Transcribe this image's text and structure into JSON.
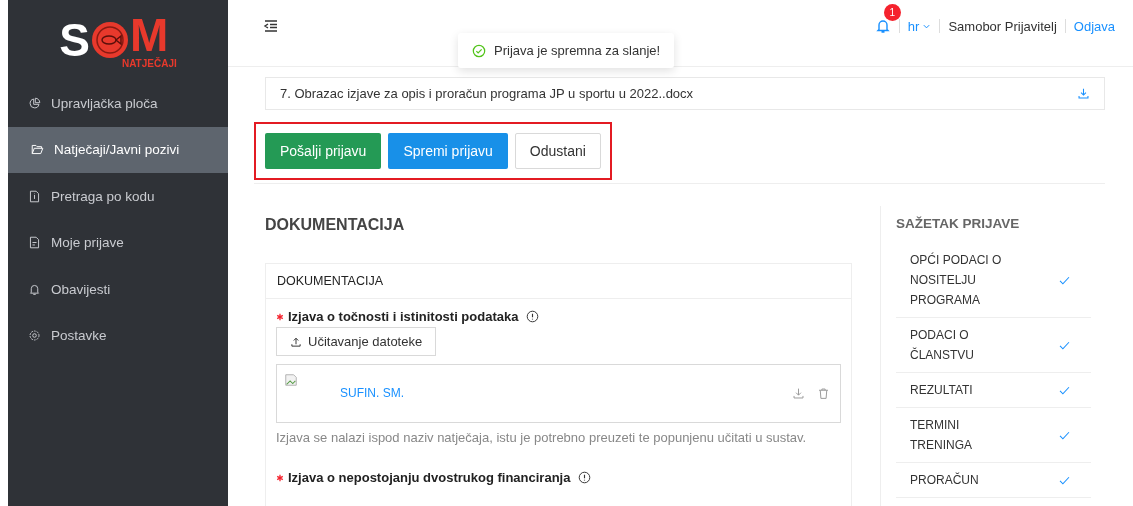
{
  "logo": {
    "letter_left": "S",
    "letter_right": "M",
    "subtitle": "NATJEČAJI"
  },
  "sidebar": {
    "items": [
      {
        "label": "Upravljačka ploča",
        "selected": false
      },
      {
        "label": "Natječaji/Javni pozivi",
        "selected": true
      },
      {
        "label": "Pretraga po kodu",
        "selected": false
      },
      {
        "label": "Moje prijave",
        "selected": false
      },
      {
        "label": "Obavijesti",
        "selected": false
      },
      {
        "label": "Postavke",
        "selected": false
      }
    ]
  },
  "header": {
    "notification_count": "1",
    "language": "hr",
    "user": "Samobor Prijavitelj",
    "logout": "Odjava"
  },
  "toast": {
    "message": "Prijava je spremna za slanje!"
  },
  "attachment": {
    "name": "7. Obrazac izjave za opis i proračun programa JP u sportu u 2022..docx"
  },
  "actions": [
    {
      "label": "Pošalji prijavu",
      "kind": "success"
    },
    {
      "label": "Spremi prijavu",
      "kind": "primary"
    },
    {
      "label": "Odustani",
      "kind": "default"
    }
  ],
  "section_title": "DOKUMENTACIJA",
  "card": {
    "title": "DOKUMENTACIJA",
    "fields": [
      {
        "label": "Izjava o točnosti i istinitosti podataka",
        "required": true,
        "upload_label": "Učitavanje datoteke",
        "file_name": "SUFIN. SM.",
        "help": "Izjava se nalazi ispod naziv natječaja, istu je potrebno preuzeti te popunjenu učitati u sustav."
      },
      {
        "label": "Izjava o nepostojanju dvostrukog financiranja",
        "required": true
      }
    ]
  },
  "summary": {
    "title": "SAŽETAK PRIJAVE",
    "items": [
      {
        "label": "OPĆI PODACI O NOSITELJU PROGRAMA",
        "completed": true
      },
      {
        "label": "PODACI O ČLANSTVU",
        "completed": true
      },
      {
        "label": "REZULTATI",
        "completed": true
      },
      {
        "label": "TERMINI TRENINGA",
        "completed": true
      },
      {
        "label": "PRORAČUN",
        "completed": true
      }
    ]
  }
}
